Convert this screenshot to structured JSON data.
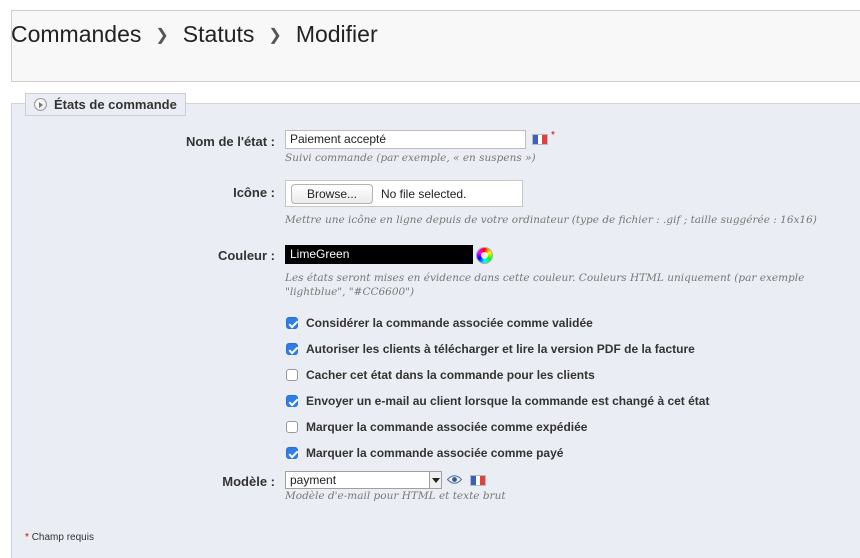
{
  "breadcrumb": [
    "Commandes",
    "Statuts",
    "Modifier"
  ],
  "fieldset": {
    "legend": "États de commande"
  },
  "fields": {
    "name": {
      "label": "Nom de l'état :",
      "value": "Paiement accepté",
      "hint": "Suivi commande (par exemple, « en suspens »)",
      "required_mark": "*"
    },
    "icon": {
      "label": "Icône :",
      "browse_label": "Browse...",
      "file_status": "No file selected.",
      "hint": "Mettre une icône en ligne depuis de votre ordinateur (type de fichier : .gif ; taille suggérée : 16x16)"
    },
    "color": {
      "label": "Couleur :",
      "value": "LimeGreen",
      "hint_line1": "Les états seront mises en évidence dans cette couleur. Couleurs HTML uniquement (par exemple",
      "hint_line2": "\"lightblue\", \"#CC6600\")"
    },
    "template": {
      "label": "Modèle :",
      "selected": "payment",
      "hint": "Modèle d'e-mail pour HTML et texte brut"
    }
  },
  "checkboxes": [
    {
      "label": "Considérer la commande associée comme validée",
      "checked": true
    },
    {
      "label": "Autoriser les clients à télécharger et lire la version PDF de la facture",
      "checked": true
    },
    {
      "label": "Cacher cet état dans la commande pour les clients",
      "checked": false
    },
    {
      "label": "Envoyer un e-mail au client lorsque la commande est changé à cet état",
      "checked": true
    },
    {
      "label": "Marquer la commande associée comme expédiée",
      "checked": false
    },
    {
      "label": "Marquer la commande associée comme payé",
      "checked": true
    }
  ],
  "footnote": {
    "star": "*",
    "text": "Champ requis"
  },
  "icons": {
    "legend": "clock-icon",
    "language": "french-flag-icon",
    "preview": "eye-icon",
    "color_picker": "color-wheel-icon"
  },
  "colors": {
    "panel_bg": "#ebedf4",
    "checkbox_checked": "#2f7ee8",
    "color_swatch": "#000000"
  }
}
